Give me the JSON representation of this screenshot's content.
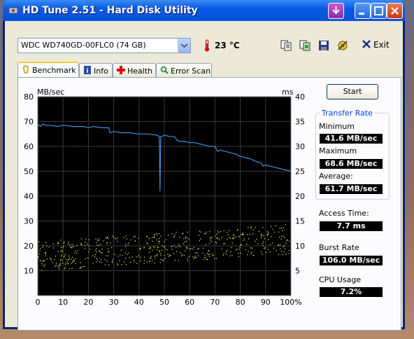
{
  "window": {
    "title": "HD Tune 2.51 - Hard Disk Utility"
  },
  "toolbar": {
    "drive": "WDC WD740GD-00FLC0 (74 GB)",
    "temperature": "23 °C",
    "exit_label": "Exit"
  },
  "tabs": [
    {
      "label": "Benchmark",
      "icon": "benchmark-icon",
      "active": true
    },
    {
      "label": "Info",
      "icon": "info-icon",
      "active": false
    },
    {
      "label": "Health",
      "icon": "health-cross-icon",
      "active": false
    },
    {
      "label": "Error Scan",
      "icon": "magnifier-icon",
      "active": false
    }
  ],
  "controls": {
    "start_label": "Start"
  },
  "results": {
    "transfer_rate_title": "Transfer Rate",
    "minimum_label": "Minimum",
    "minimum_value": "41.6 MB/sec",
    "maximum_label": "Maximum",
    "maximum_value": "68.6 MB/sec",
    "average_label": "Average:",
    "average_value": "61.7 MB/sec",
    "access_time_label": "Access Time:",
    "access_time_value": "7.7 ms",
    "burst_rate_label": "Burst Rate",
    "burst_rate_value": "106.0 MB/sec",
    "cpu_usage_label": "CPU Usage",
    "cpu_usage_value": "7.2%"
  },
  "chart_data": {
    "type": "line",
    "left_axis_label": "MB/sec",
    "right_axis_label": "ms",
    "left_ylim": [
      0,
      80
    ],
    "right_ylim": [
      0,
      40
    ],
    "xlim": [
      0,
      100
    ],
    "left_ticks": [
      "10",
      "20",
      "30",
      "40",
      "50",
      "60",
      "70",
      "80"
    ],
    "right_ticks": [
      "5",
      "10",
      "15",
      "20",
      "25",
      "30",
      "35",
      "40"
    ],
    "x_ticks": [
      "0",
      "10",
      "20",
      "30",
      "40",
      "50",
      "60",
      "70",
      "80",
      "90",
      "100%"
    ],
    "grid": true,
    "colors": {
      "background": "#000000",
      "grid": "#3a3a3a",
      "transfer": "#3e8ed8",
      "access": "#d8d85a"
    },
    "series": [
      {
        "values_x": [
          0,
          1,
          2,
          3,
          5,
          8,
          10,
          14,
          18,
          20,
          22,
          25,
          28,
          28.5,
          30,
          33,
          36,
          40,
          44,
          47,
          48,
          48.3,
          48.6,
          49,
          50,
          52,
          54,
          55,
          56,
          58,
          60,
          62,
          64,
          66,
          68,
          70,
          71,
          72,
          74,
          76,
          78,
          80,
          82,
          84,
          86,
          88,
          89,
          90,
          92,
          94,
          96,
          98,
          100
        ],
        "values_y": [
          69,
          68,
          69,
          68.5,
          68.5,
          68,
          68.5,
          68,
          68,
          67.5,
          68,
          67.5,
          67.5,
          65.5,
          66,
          65.5,
          65.5,
          65,
          65,
          64.5,
          64,
          42,
          64,
          64,
          64.5,
          64,
          64,
          62.5,
          62,
          62,
          61.5,
          61.5,
          61,
          60.5,
          60,
          60,
          58,
          58.5,
          58,
          57.5,
          57,
          56,
          55.5,
          55,
          54,
          53.5,
          52,
          52.5,
          52,
          51.5,
          51,
          50.5,
          50
        ]
      },
      {
        "type": "scatter",
        "note_points": 0
      }
    ]
  }
}
